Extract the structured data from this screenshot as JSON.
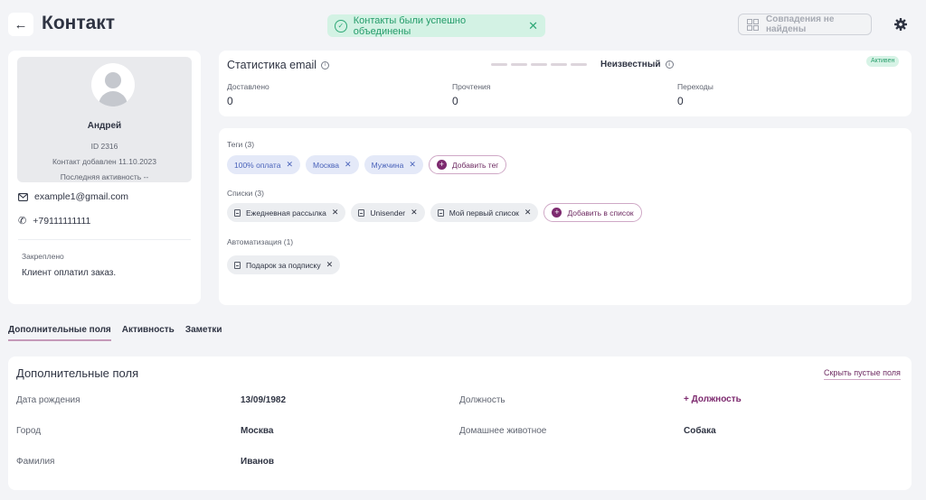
{
  "header": {
    "back_icon": "←",
    "title": "Контакт",
    "toast_text": "Контакты были успешно объединены",
    "toast_close": "✕",
    "duplicates_label": "Совпадения не найдены"
  },
  "profile": {
    "name": "Андрей",
    "id_line": "ID 2316",
    "added_line": "Контакт добавлен 11.10.2023",
    "activity_line": "Последняя активность --",
    "email": "example1@gmail.com",
    "phone": "+79111111111",
    "pinned_label": "Закреплено",
    "pinned_text": "Клиент оплатил заказ."
  },
  "stats": {
    "title": "Статистика email",
    "info_glyph": "i",
    "status_label": "Неизвестный",
    "badge": "Активен",
    "items": [
      {
        "label": "Доставлено",
        "value": "0"
      },
      {
        "label": "Прочтения",
        "value": "0"
      },
      {
        "label": "Переходы",
        "value": "0"
      }
    ]
  },
  "tags": {
    "label": "Теги (3)",
    "items": [
      "100% оплата",
      "Москва",
      "Мужчина"
    ],
    "add_label": "Добавить тег"
  },
  "lists": {
    "label": "Списки (3)",
    "items": [
      "Ежедневная рассылка",
      "Unisender",
      "Мой первый список"
    ],
    "add_label": "Добавить в список"
  },
  "automation": {
    "label": "Автоматизация (1)",
    "items": [
      "Подарок за подписку"
    ]
  },
  "chip_close": "✕",
  "chip_plus": "+",
  "tabs": [
    "Дополнительные поля",
    "Активность",
    "Заметки"
  ],
  "fields": {
    "title": "Дополнительные поля",
    "hide_empty": "Скрыть пустые поля",
    "birthday_label": "Дата рождения",
    "birthday_value": "13/09/1982",
    "position_label": "Должность",
    "position_add": "+ Должность",
    "city_label": "Город",
    "city_value": "Москва",
    "pet_label": "Домашнее животное",
    "pet_value": "Собака",
    "surname_label": "Фамилия",
    "surname_value": "Иванов"
  },
  "colors": {
    "accent": "#7d2a6f",
    "success": "#249c6a",
    "tag_text": "#4a63ba",
    "background": "#f3f4f7"
  }
}
